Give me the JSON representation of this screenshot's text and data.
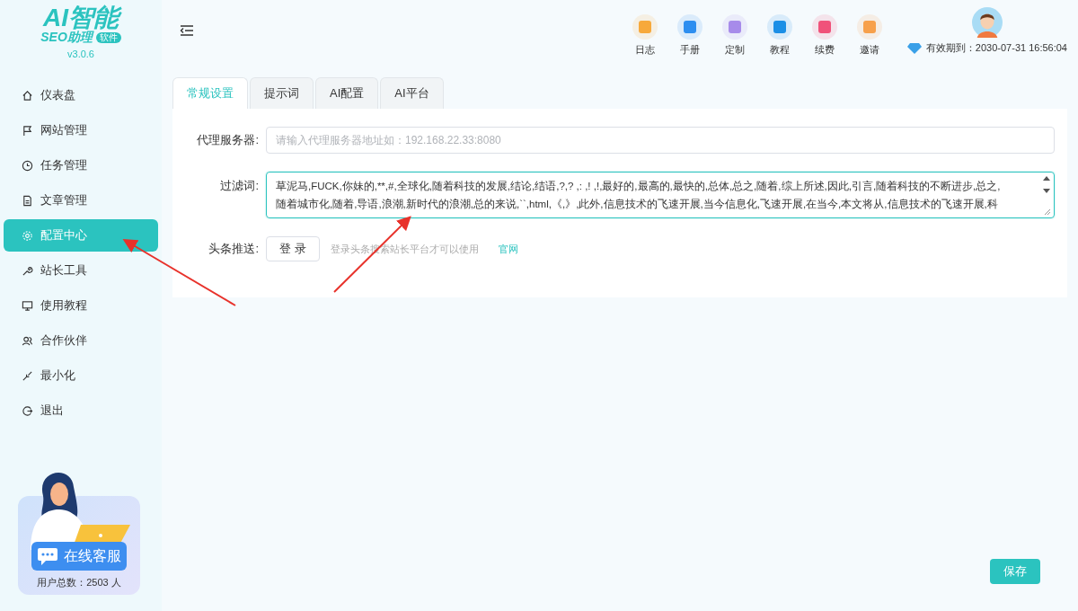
{
  "logo": {
    "title": "AI智能",
    "subtitle": "SEO助理",
    "badge": "软件",
    "version": "v3.0.6"
  },
  "sidebar": {
    "items": [
      {
        "label": "仪表盘",
        "selected": false
      },
      {
        "label": "网站管理",
        "selected": false
      },
      {
        "label": "任务管理",
        "selected": false
      },
      {
        "label": "文章管理",
        "selected": false
      },
      {
        "label": "配置中心",
        "selected": true
      },
      {
        "label": "站长工具",
        "selected": false
      },
      {
        "label": "使用教程",
        "selected": false
      },
      {
        "label": "合作伙伴",
        "selected": false
      },
      {
        "label": "最小化",
        "selected": false
      },
      {
        "label": "退出",
        "selected": false
      }
    ]
  },
  "support": {
    "button": "在线客服",
    "users": "用户总数：2503 人"
  },
  "toolbar": [
    {
      "label": "日志",
      "color": "#f7a93b"
    },
    {
      "label": "手册",
      "color": "#2d8ef0"
    },
    {
      "label": "定制",
      "color": "#a78bea"
    },
    {
      "label": "教程",
      "color": "#1b8fe6"
    },
    {
      "label": "续费",
      "color": "#f0527a"
    },
    {
      "label": "邀请",
      "color": "#f7a04b"
    }
  ],
  "expiry": "有效期到：2030-07-31 16:56:04",
  "tabs": [
    {
      "label": "常规设置",
      "selected": true
    },
    {
      "label": "提示词",
      "selected": false
    },
    {
      "label": "AI配置",
      "selected": false
    },
    {
      "label": "AI平台",
      "selected": false
    }
  ],
  "form": {
    "proxy": {
      "label": "代理服务器:",
      "placeholder": "请输入代理服务器地址如：192.168.22.33:8080"
    },
    "filter": {
      "label": "过滤词:",
      "lines": [
        "草泥马,FUCK,你妹的,**,#,全球化,随着科技的发展,结论,结语,?,?  ,:  ,!  ,!,最好的,最高的,最快的,总体,总之,随着,综上所述,因此,引言,随着科技的不断进步,总之,",
        "随着城市化,随着,导语,浪潮,新时代的浪潮,总的来说,``,html,《,》,此外,信息技术的飞速开展,当今信息化,飞速开展,在当今,本文将从,信息技术的飞速开展,科"
      ]
    },
    "toutiao": {
      "label": "头条推送:",
      "button": "登 录",
      "hint": "登录头条搜索站长平台才可以使用",
      "link": "官网"
    }
  },
  "save": "保存"
}
